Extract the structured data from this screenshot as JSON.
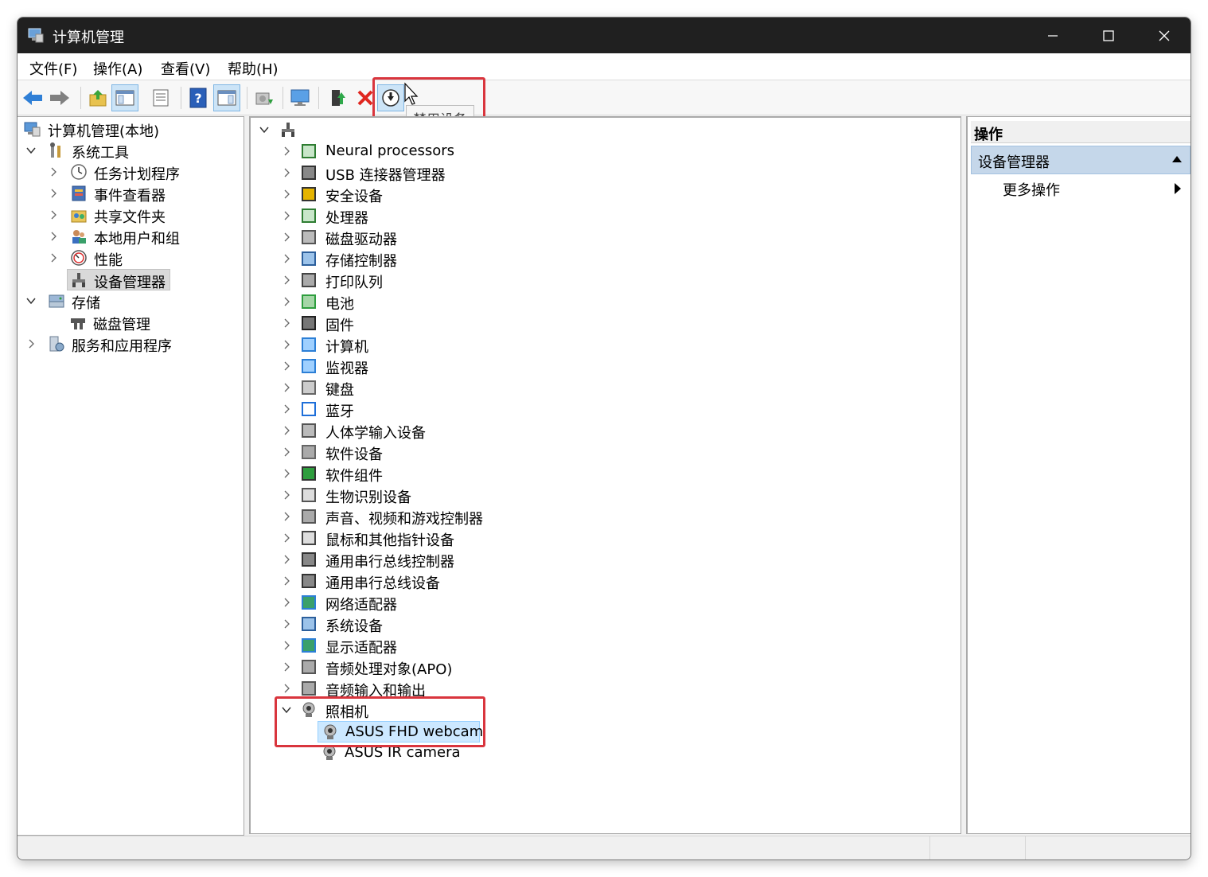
{
  "window": {
    "title": "计算机管理",
    "minimize": "—",
    "maximize": "☐",
    "close": "✕"
  },
  "menu": [
    "文件(F)",
    "操作(A)",
    "查看(V)",
    "帮助(H)"
  ],
  "tooltip": "禁用设备",
  "left_tree": {
    "root": "计算机管理(本地)",
    "system_tools": "系统工具",
    "items": [
      "任务计划程序",
      "事件查看器",
      "共享文件夹",
      "本地用户和组",
      "性能",
      "设备管理器"
    ],
    "storage": "存储",
    "disk_mgmt": "磁盘管理",
    "services": "服务和应用程序"
  },
  "device_tree": {
    "categories": [
      "Neural processors",
      "USB 连接器管理器",
      "安全设备",
      "处理器",
      "磁盘驱动器",
      "存储控制器",
      "打印队列",
      "电池",
      "固件",
      "计算机",
      "监视器",
      "键盘",
      "蓝牙",
      "人体学输入设备",
      "软件设备",
      "软件组件",
      "生物识别设备",
      "声音、视频和游戏控制器",
      "鼠标和其他指针设备",
      "通用串行总线控制器",
      "通用串行总线设备",
      "网络适配器",
      "系统设备",
      "显示适配器",
      "音频处理对象(APO)",
      "音频输入和输出"
    ],
    "camera_category": "照相机",
    "camera_devices": [
      "ASUS FHD webcam",
      "ASUS IR camera"
    ]
  },
  "actions": {
    "header": "操作",
    "section": "设备管理器",
    "more": "更多操作"
  },
  "colors": {
    "titlebar": "#202020",
    "highlight_red": "#d9353d",
    "selection_blue": "#cce8ff",
    "section_blue": "#c5d7ea"
  }
}
